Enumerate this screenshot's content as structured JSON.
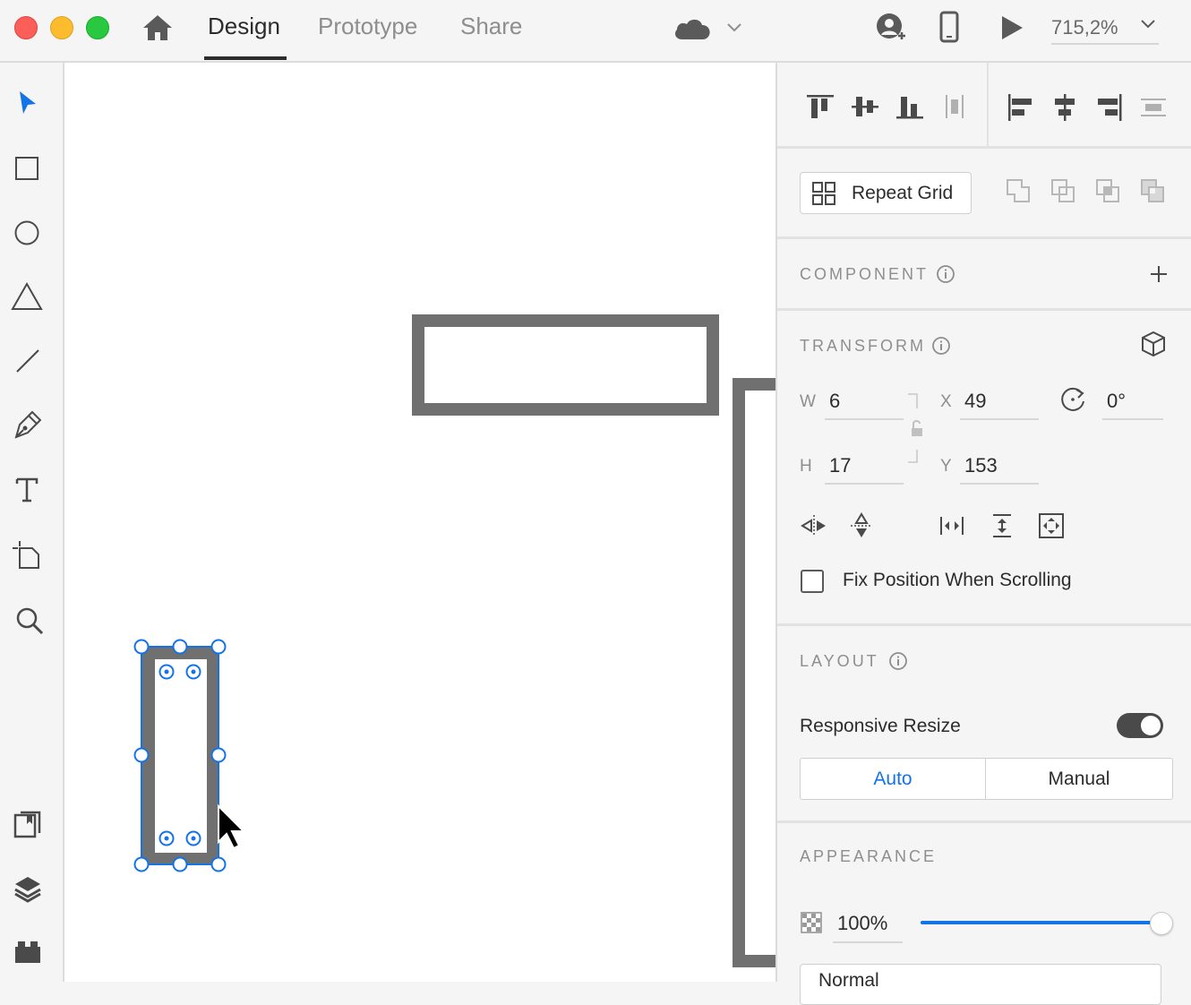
{
  "window": {
    "traffic_colors": {
      "close": "#fc5f57",
      "minimize": "#fdbc2e",
      "zoom": "#28c840"
    }
  },
  "topbar": {
    "tabs": [
      {
        "label": "Design",
        "active": true
      },
      {
        "label": "Prototype",
        "active": false
      },
      {
        "label": "Share",
        "active": false
      }
    ],
    "zoom": "715,2%",
    "icons": [
      "home-icon",
      "cloud-icon",
      "chevron-down-icon",
      "share-user-icon",
      "device-preview-icon",
      "play-icon",
      "zoom-dropdown-icon"
    ]
  },
  "tools": [
    "select-icon",
    "rectangle-icon",
    "ellipse-icon",
    "polygon-icon",
    "line-icon",
    "pen-icon",
    "text-icon",
    "artboard-icon",
    "zoom-tool-icon",
    "assets-icon",
    "layers-icon",
    "plugins-icon"
  ],
  "panel": {
    "repeat_grid_label": "Repeat Grid",
    "component": {
      "title": "COMPONENT"
    },
    "transform": {
      "title": "TRANSFORM",
      "w_label": "W",
      "w": "6",
      "x_label": "X",
      "x": "49",
      "h_label": "H",
      "h": "17",
      "y_label": "Y",
      "y": "153",
      "rotation": "0°",
      "fix_position_label": "Fix Position When Scrolling"
    },
    "layout": {
      "title": "LAYOUT",
      "responsive_resize_label": "Responsive Resize",
      "auto_label": "Auto",
      "manual_label": "Manual"
    },
    "appearance": {
      "title": "APPEARANCE",
      "opacity": "100%",
      "opacity_value": 1.0,
      "blend_mode": "Normal"
    }
  },
  "colors": {
    "accent": "#1473e6",
    "shape_stroke": "#707070"
  }
}
